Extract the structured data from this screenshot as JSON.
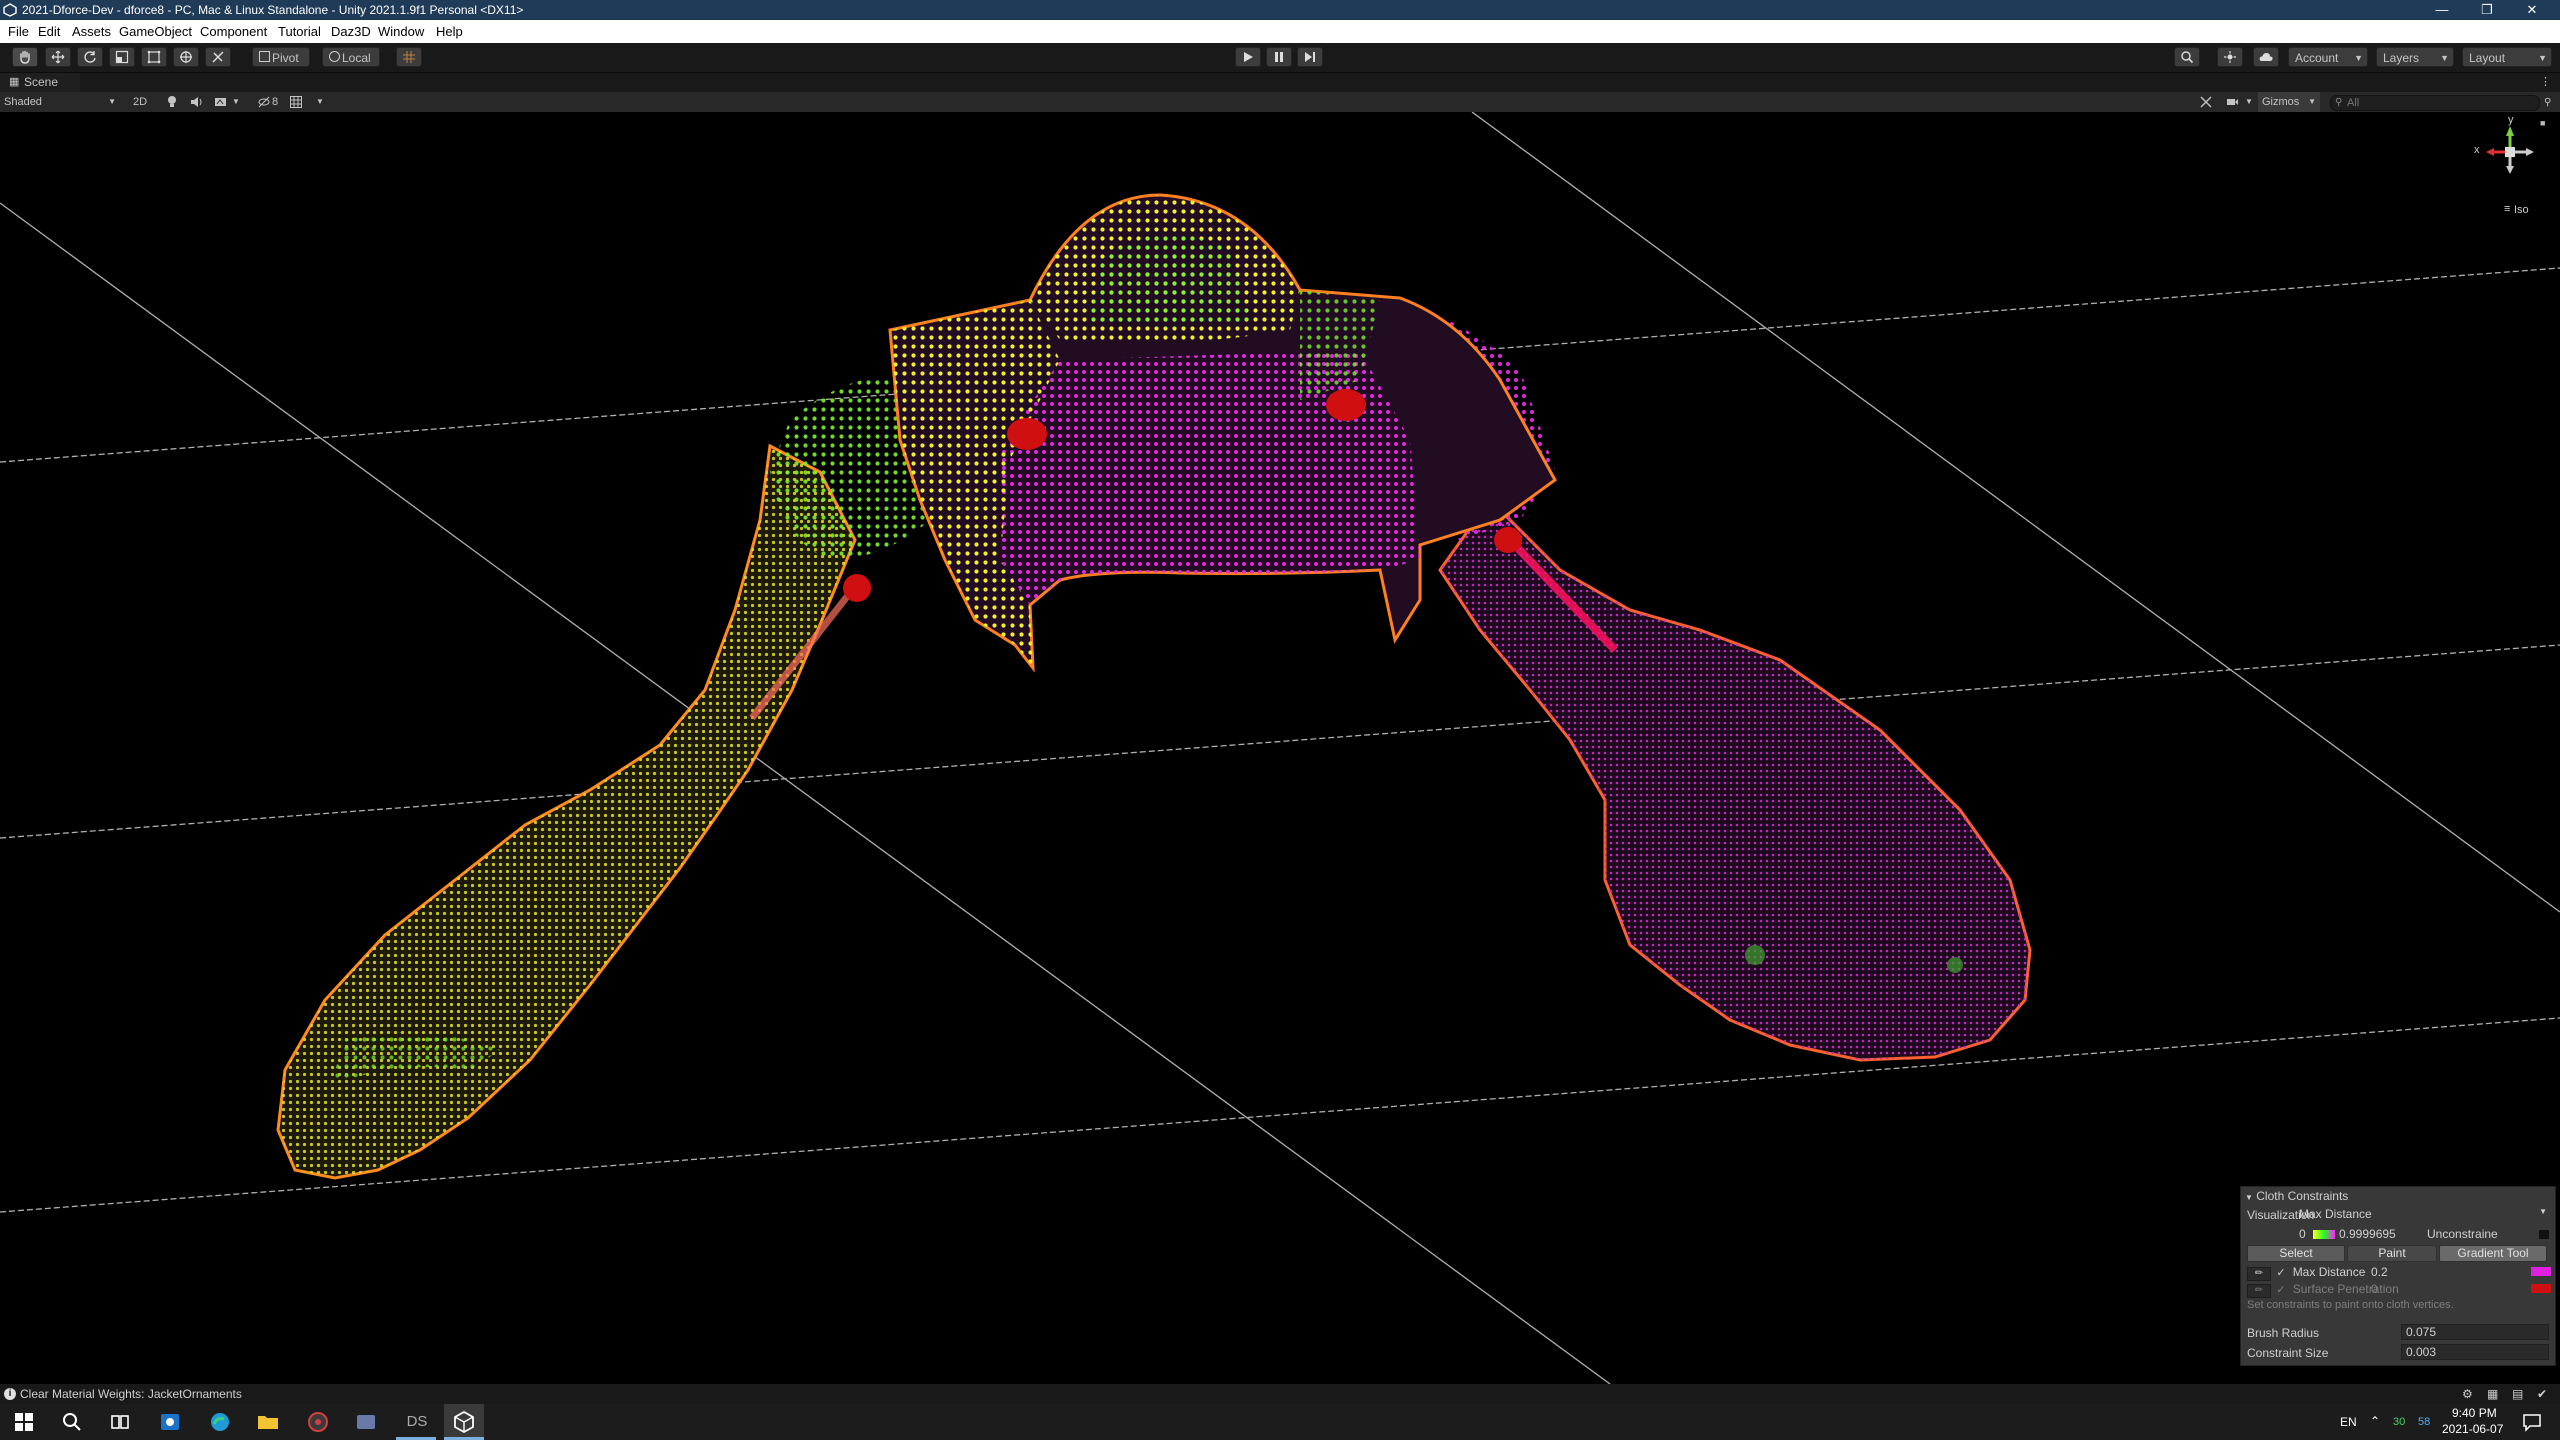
{
  "window": {
    "title": "2021-Dforce-Dev - dforce8 - PC, Mac & Linux Standalone - Unity 2021.1.9f1 Personal <DX11>"
  },
  "menu": [
    "File",
    "Edit",
    "Assets",
    "GameObject",
    "Component",
    "Tutorial",
    "Daz3D",
    "Window",
    "Help"
  ],
  "toolbar": {
    "pivot": "Pivot",
    "local": "Local",
    "account": "Account",
    "layers": "Layers",
    "layout": "Layout"
  },
  "scene": {
    "tab_label": "Scene",
    "shading_mode": "Shaded",
    "mode_2d": "2D",
    "hidden_count": "8",
    "gizmos": "Gizmos",
    "search_placeholder": "All",
    "axis_x": "x",
    "axis_y": "y",
    "projection": "Iso"
  },
  "cloth_panel": {
    "title": "Cloth Constraints",
    "visualization_label": "Visualization",
    "visualization_value": "Max Distance",
    "gradient_min": "0",
    "gradient_max": "0.9999695",
    "unconstrained": "Unconstraine",
    "tabs": [
      "Select",
      "Paint",
      "Gradient Tool"
    ],
    "active_tab": "Gradient Tool",
    "max_distance_label": "Max Distance",
    "max_distance_value": "0.2",
    "surface_penetration_label": "Surface Penetration",
    "surface_penetration_value": "0",
    "hint": "Set constraints to paint onto cloth vertices.",
    "brush_radius_label": "Brush Radius",
    "brush_radius_value": "0.075",
    "constraint_size_label": "Constraint Size",
    "constraint_size_value": "0.003",
    "colors": {
      "max_distance": "#e020e0",
      "surface_penetration": "#d01010"
    }
  },
  "status": {
    "message": "Clear Material Weights: JacketOrnaments"
  },
  "taskbar": {
    "ds_label": "DS",
    "lang": "EN",
    "temp1": "30",
    "temp2": "58",
    "time": "9:40 PM",
    "date": "2021-06-07"
  },
  "colors": {
    "title_bar": "#1f3b57",
    "wire_yellow": "#f0f020",
    "wire_magenta": "#e020e0",
    "wire_outline": "#ff8020",
    "constraint_red": "#d01010"
  }
}
